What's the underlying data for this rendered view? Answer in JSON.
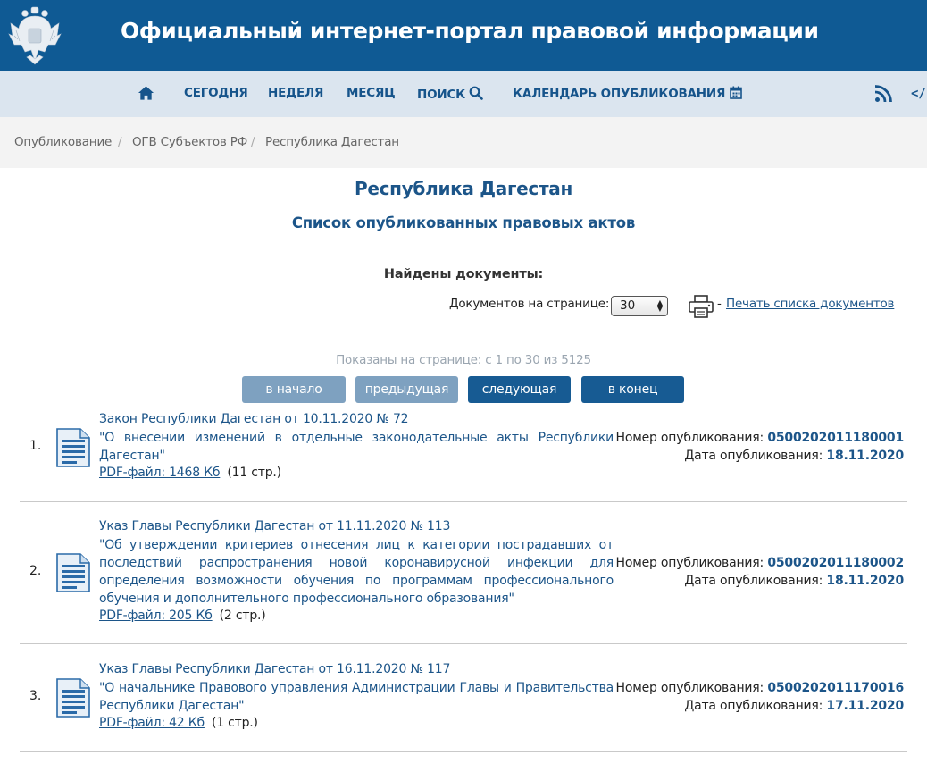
{
  "header": {
    "title": "Официальный интернет-портал правовой информации"
  },
  "nav": {
    "home_icon": "home-icon",
    "items": [
      "СЕГОДНЯ",
      "НЕДЕЛЯ",
      "МЕСЯЦ",
      "ПОИСК",
      "КАЛЕНДАРЬ ОПУБЛИКОВАНИЯ"
    ],
    "rss_icon": "rss-icon",
    "embed_label": "</"
  },
  "breadcrumb": [
    "Опубликование",
    "ОГВ Субъектов РФ",
    "Республика Дагестан"
  ],
  "page": {
    "title": "Республика Дагестан",
    "subtitle": "Список опубликованных правовых актов",
    "found_label": "Найдены документы:",
    "per_page_label": "Документов на странице:",
    "per_page_value": "30",
    "print_dash": "-",
    "print_link": "Печать списка документов",
    "shown_text": "Показаны на странице: с 1 по 30 из 5125"
  },
  "pager": {
    "first": "в начало",
    "prev": "предыдущая",
    "next": "следующая",
    "last": "в конец"
  },
  "documents": [
    {
      "num": "1.",
      "title": "Закон Республики Дагестан от 10.11.2020 № 72",
      "desc": "\"О внесении изменений в отдельные законодательные акты Республики Дагестан\"",
      "pdf": "PDF-файл: 1468 Кб",
      "pages": "(11 стр.)",
      "pub_num_label": "Номер опубликования:",
      "pub_num": "0500202011180001",
      "pub_date_label": "Дата опубликования:",
      "pub_date": "18.11.2020"
    },
    {
      "num": "2.",
      "title": "Указ Главы Республики Дагестан от 11.11.2020 № 113",
      "desc": "\"Об утверждении критериев отнесения лиц к категории пострадавших от последствий распространения новой коронавирусной инфекции для определения возможности обучения по программам профессионального обучения и дополнительного профессионального образования\"",
      "pdf": "PDF-файл: 205 Кб",
      "pages": "(2 стр.)",
      "pub_num_label": "Номер опубликования:",
      "pub_num": "0500202011180002",
      "pub_date_label": "Дата опубликования:",
      "pub_date": "18.11.2020"
    },
    {
      "num": "3.",
      "title": "Указ Главы Республики Дагестан от 16.11.2020 № 117",
      "desc": "\"О начальнике Правового управления Администрации Главы и Правительства Республики Дагестан\"",
      "pdf": "PDF-файл: 42 Кб",
      "pages": "(1 стр.)",
      "pub_num_label": "Номер опубликования:",
      "pub_num": "0500202011170016",
      "pub_date_label": "Дата опубликования:",
      "pub_date": "17.11.2020"
    }
  ],
  "colors": {
    "header_bg": "#0f5a94",
    "nav_bg": "#dbe5ef",
    "accent": "#1c5589",
    "button_active": "#175b93",
    "button_disabled": "#7ea1c0"
  }
}
